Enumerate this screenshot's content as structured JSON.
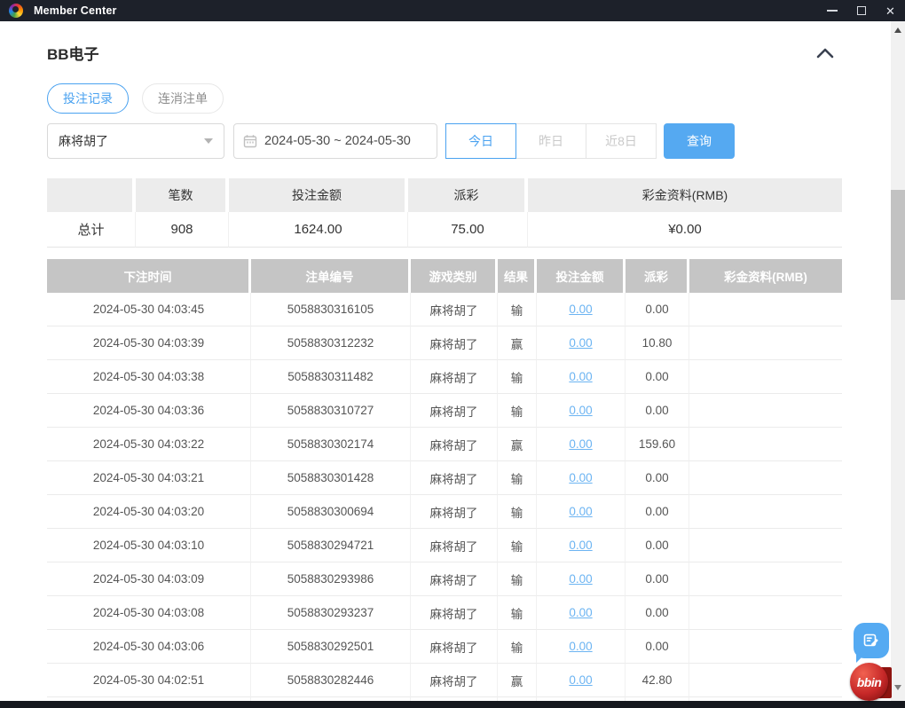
{
  "titlebar": {
    "title": "Member Center"
  },
  "page": {
    "title": "BB电子"
  },
  "tabs": {
    "bet_records": "投注记录",
    "cancelled_orders": "连消注单"
  },
  "filters": {
    "game_select_value": "麻将胡了",
    "date_range_value": "2024-05-30 ~ 2024-05-30",
    "quick_today": "今日",
    "quick_yesterday": "昨日",
    "quick_8days": "近8日",
    "search_label": "查询"
  },
  "summary": {
    "headers": [
      "",
      "笔数",
      "投注金额",
      "派彩",
      "彩金资料(RMB)"
    ],
    "row": {
      "label": "总计",
      "count": "908",
      "bet_amount": "1624.00",
      "payout": "75.00",
      "bonus": "¥0.00"
    }
  },
  "table": {
    "headers": [
      "下注时间",
      "注单编号",
      "游戏类别",
      "结果",
      "投注金额",
      "派彩",
      "彩金资料(RMB)"
    ],
    "rows": [
      {
        "time": "2024-05-30 04:03:45",
        "order_no": "5058830316105",
        "game": "麻将胡了",
        "result": "输",
        "bet": "0.00",
        "payout": "0.00",
        "bonus": ""
      },
      {
        "time": "2024-05-30 04:03:39",
        "order_no": "5058830312232",
        "game": "麻将胡了",
        "result": "赢",
        "bet": "0.00",
        "payout": "10.80",
        "bonus": ""
      },
      {
        "time": "2024-05-30 04:03:38",
        "order_no": "5058830311482",
        "game": "麻将胡了",
        "result": "输",
        "bet": "0.00",
        "payout": "0.00",
        "bonus": ""
      },
      {
        "time": "2024-05-30 04:03:36",
        "order_no": "5058830310727",
        "game": "麻将胡了",
        "result": "输",
        "bet": "0.00",
        "payout": "0.00",
        "bonus": ""
      },
      {
        "time": "2024-05-30 04:03:22",
        "order_no": "5058830302174",
        "game": "麻将胡了",
        "result": "赢",
        "bet": "0.00",
        "payout": "159.60",
        "bonus": ""
      },
      {
        "time": "2024-05-30 04:03:21",
        "order_no": "5058830301428",
        "game": "麻将胡了",
        "result": "输",
        "bet": "0.00",
        "payout": "0.00",
        "bonus": ""
      },
      {
        "time": "2024-05-30 04:03:20",
        "order_no": "5058830300694",
        "game": "麻将胡了",
        "result": "输",
        "bet": "0.00",
        "payout": "0.00",
        "bonus": ""
      },
      {
        "time": "2024-05-30 04:03:10",
        "order_no": "5058830294721",
        "game": "麻将胡了",
        "result": "输",
        "bet": "0.00",
        "payout": "0.00",
        "bonus": ""
      },
      {
        "time": "2024-05-30 04:03:09",
        "order_no": "5058830293986",
        "game": "麻将胡了",
        "result": "输",
        "bet": "0.00",
        "payout": "0.00",
        "bonus": ""
      },
      {
        "time": "2024-05-30 04:03:08",
        "order_no": "5058830293237",
        "game": "麻将胡了",
        "result": "输",
        "bet": "0.00",
        "payout": "0.00",
        "bonus": ""
      },
      {
        "time": "2024-05-30 04:03:06",
        "order_no": "5058830292501",
        "game": "麻将胡了",
        "result": "输",
        "bet": "0.00",
        "payout": "0.00",
        "bonus": ""
      },
      {
        "time": "2024-05-30 04:02:51",
        "order_no": "5058830282446",
        "game": "麻将胡了",
        "result": "赢",
        "bet": "0.00",
        "payout": "42.80",
        "bonus": ""
      }
    ]
  },
  "floating": {
    "bbin_logo_text": "bbin"
  },
  "colors": {
    "accent": "#4aa2f0",
    "search_button": "#55a9f1",
    "link": "#6cb4f2",
    "table_header_bg": "#c5c5c5",
    "titlebar_bg": "#1d212a"
  }
}
